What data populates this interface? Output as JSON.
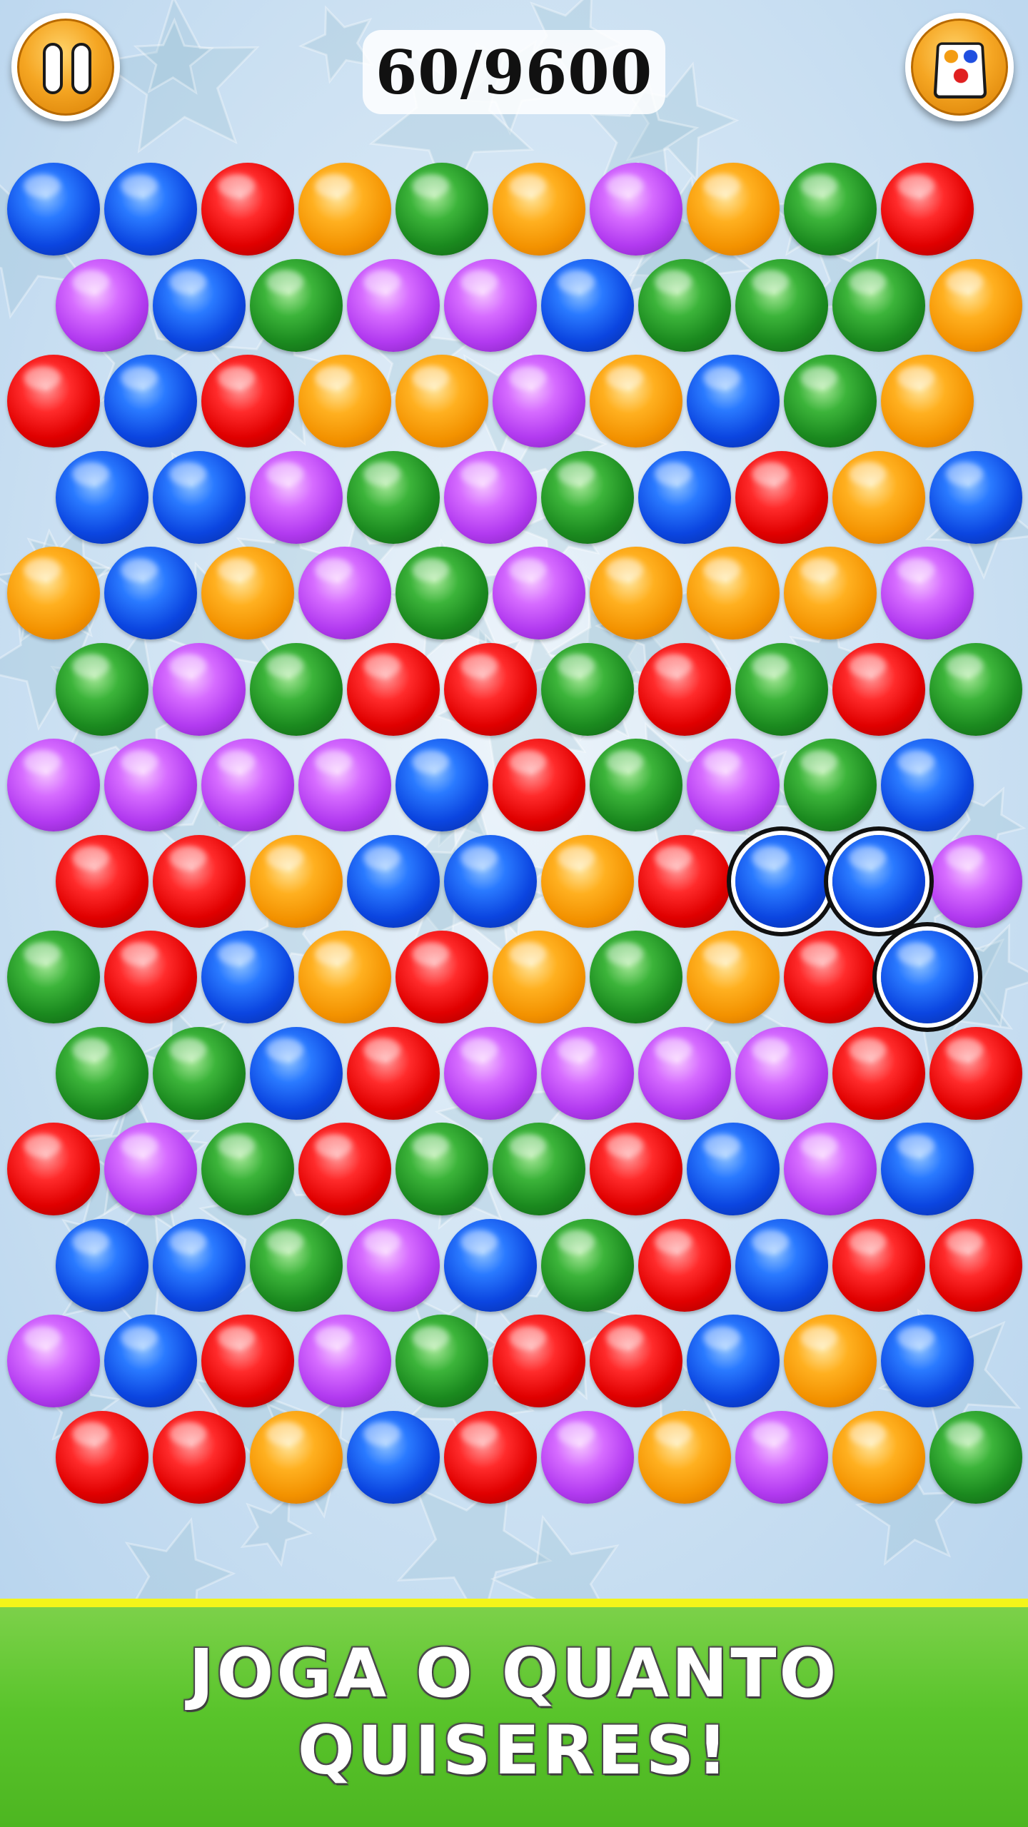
{
  "hud": {
    "score": "60/9600",
    "pause_icon": "pause-icon",
    "colors_icon": "color-cards-icon"
  },
  "banner": {
    "line1": "JOGA O QUANTO",
    "line2": "QUISERES!"
  },
  "colors": {
    "blue": "#0b45e0",
    "red": "#e00000",
    "orange": "#f39200",
    "green": "#1b8a1f",
    "purple": "#b23af0",
    "banner_green": "#59c42b",
    "banner_line": "#f4f51a",
    "hud_orange": "#f5a623"
  },
  "board": {
    "rows": [
      [
        "blue",
        "blue",
        "red",
        "orange",
        "green",
        "orange",
        "purple",
        "orange",
        "green",
        "red"
      ],
      [
        "purple",
        "blue",
        "green",
        "purple",
        "purple",
        "blue",
        "green",
        "green",
        "green",
        "orange"
      ],
      [
        "red",
        "blue",
        "red",
        "orange",
        "orange",
        "purple",
        "orange",
        "blue",
        "green",
        "orange"
      ],
      [
        "blue",
        "blue",
        "purple",
        "green",
        "purple",
        "green",
        "blue",
        "red",
        "orange",
        "blue"
      ],
      [
        "orange",
        "blue",
        "orange",
        "purple",
        "green",
        "purple",
        "orange",
        "orange",
        "orange",
        "purple"
      ],
      [
        "green",
        "purple",
        "green",
        "red",
        "red",
        "green",
        "red",
        "green",
        "red",
        "green"
      ],
      [
        "purple",
        "purple",
        "purple",
        "purple",
        "blue",
        "red",
        "green",
        "purple",
        "green",
        "blue"
      ],
      [
        "red",
        "red",
        "orange",
        "blue",
        "blue",
        "orange",
        "red",
        "blue",
        "blue",
        "purple"
      ],
      [
        "green",
        "red",
        "blue",
        "orange",
        "red",
        "orange",
        "green",
        "orange",
        "red",
        "blue"
      ],
      [
        "green",
        "green",
        "blue",
        "red",
        "purple",
        "purple",
        "purple",
        "purple",
        "red",
        "red"
      ],
      [
        "red",
        "purple",
        "green",
        "red",
        "green",
        "green",
        "red",
        "blue",
        "purple",
        "blue"
      ],
      [
        "blue",
        "blue",
        "green",
        "purple",
        "blue",
        "green",
        "red",
        "blue",
        "red",
        "red"
      ],
      [
        "purple",
        "blue",
        "red",
        "purple",
        "green",
        "red",
        "red",
        "blue",
        "orange",
        "blue"
      ],
      [
        "red",
        "red",
        "orange",
        "blue",
        "red",
        "purple",
        "orange",
        "purple",
        "orange",
        "green"
      ]
    ],
    "selected": [
      [
        7,
        7
      ],
      [
        7,
        8
      ],
      [
        8,
        9
      ]
    ]
  }
}
